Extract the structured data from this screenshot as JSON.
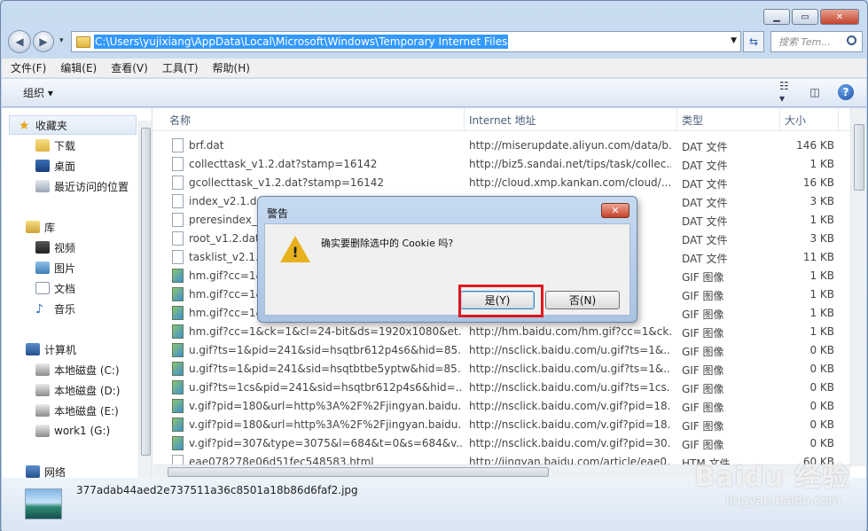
{
  "address": {
    "path": "C:\\Users\\yujixiang\\AppData\\Local\\Microsoft\\Windows\\Temporary Internet Files"
  },
  "search": {
    "placeholder": "搜索 Tem..."
  },
  "menu": [
    "文件(F)",
    "编辑(E)",
    "查看(V)",
    "工具(T)",
    "帮助(H)"
  ],
  "toolbar": {
    "organize": "组织 ▾"
  },
  "nav": {
    "favorites": "收藏夹",
    "downloads": "下载",
    "desktop": "桌面",
    "recent": "最近访问的位置",
    "libraries": "库",
    "videos": "视频",
    "pictures": "图片",
    "documents": "文档",
    "music": "音乐",
    "computer": "计算机",
    "drive_c": "本地磁盘 (C:)",
    "drive_d": "本地磁盘 (D:)",
    "drive_e": "本地磁盘 (E:)",
    "drive_g": "work1 (G:)",
    "network": "网络"
  },
  "columns": {
    "name": "名称",
    "address": "Internet 地址",
    "type": "类型",
    "size": "大小"
  },
  "rows": [
    {
      "name": "brf.dat",
      "addr": "http://miserupdate.aliyun.com/data/b...",
      "type": "DAT 文件",
      "size": "146 KB"
    },
    {
      "name": "collecttask_v1.2.dat?stamp=16142",
      "addr": "http://biz5.sandai.net/tips/task/collec...",
      "type": "DAT 文件",
      "size": "1 KB"
    },
    {
      "name": "gcollecttask_v1.2.dat?stamp=16142",
      "addr": "http://cloud.xmp.kankan.com/cloud/...",
      "type": "DAT 文件",
      "size": "16 KB"
    },
    {
      "name": "index_v2.1.dat",
      "addr": "ud/i...",
      "type": "DAT 文件",
      "size": "3 KB"
    },
    {
      "name": "preresindex_v...",
      "addr": "ud/xm...",
      "type": "DAT 文件",
      "size": "1 KB"
    },
    {
      "name": "root_v1.2.dat",
      "addr": "ud/r...",
      "type": "DAT 文件",
      "size": "3 KB"
    },
    {
      "name": "tasklist_v2.1.d...",
      "addr": "ud/r...",
      "type": "DAT 文件",
      "size": "11 KB"
    },
    {
      "name": "hm.gif?cc=1&...",
      "addr": "&ck...",
      "type": "GIF 图像",
      "size": "1 KB"
    },
    {
      "name": "hm.gif?cc=1&...",
      "addr": "&ck...",
      "type": "GIF 图像",
      "size": "1 KB"
    },
    {
      "name": "hm.gif?cc=1&...",
      "addr": "&ck...",
      "type": "GIF 图像",
      "size": "1 KB"
    },
    {
      "name": "hm.gif?cc=1&ck=1&cl=24-bit&ds=1920x1080&et...",
      "addr": "http://hm.baidu.com/hm.gif?cc=1&ck...",
      "type": "GIF 图像",
      "size": "1 KB"
    },
    {
      "name": "u.gif?ts=1&pid=241&sid=hsqtbr612p4s6&hid=85...",
      "addr": "http://nsclick.baidu.com/u.gif?ts=1&...",
      "type": "GIF 图像",
      "size": "0 KB"
    },
    {
      "name": "u.gif?ts=1&pid=241&sid=hsqtbtbe5yptw&hid=85...",
      "addr": "http://nsclick.baidu.com/u.gif?ts=1&...",
      "type": "GIF 图像",
      "size": "0 KB"
    },
    {
      "name": "u.gif?ts=1cs&pid=241&sid=hsqtbr612p4s6&hid=...",
      "addr": "http://nsclick.baidu.com/u.gif?ts=1cs...",
      "type": "GIF 图像",
      "size": "0 KB"
    },
    {
      "name": "v.gif?pid=180&url=http%3A%2F%2Fjingyan.baidu....",
      "addr": "http://nsclick.baidu.com/v.gif?pid=18...",
      "type": "GIF 图像",
      "size": "0 KB"
    },
    {
      "name": "v.gif?pid=180&url=http%3A%2F%2Fjingyan.baidu....",
      "addr": "http://nsclick.baidu.com/v.gif?pid=18...",
      "type": "GIF 图像",
      "size": "0 KB"
    },
    {
      "name": "v.gif?pid=307&type=3075&l=684&t=0&s=684&v...",
      "addr": "http://nsclick.baidu.com/v.gif?pid=30...",
      "type": "GIF 图像",
      "size": "0 KB"
    },
    {
      "name": "eae078278e06d51fec548583.html",
      "addr": "http://jingyan.baidu.com/article/eae0...",
      "type": "HTM 文件",
      "size": "60 KB"
    }
  ],
  "details": {
    "filename": "377adab44aed2e737511a36c8501a18b86d6faf2.jpg"
  },
  "dialog": {
    "title": "警告",
    "message": "确实要删除选中的 Cookie 吗?",
    "yes": "是(Y)",
    "no": "否(N)"
  },
  "watermark": {
    "brand": "Baidu 经验",
    "url": "jingyan.baidu.com"
  }
}
